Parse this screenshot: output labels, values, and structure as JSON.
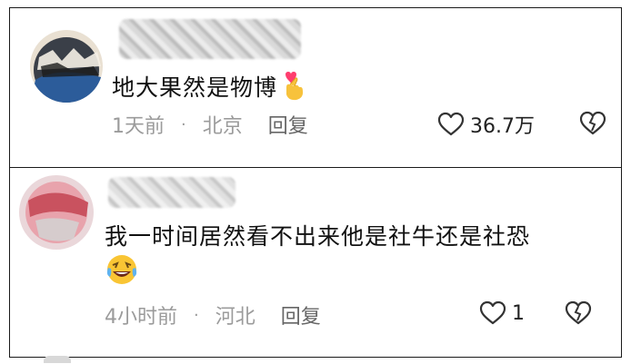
{
  "comments": [
    {
      "text": "地大果然是物博",
      "time": "1天前",
      "location": "北京",
      "reply_label": "回复",
      "likes": "36.7万",
      "emoji": "hand-heart-emoji"
    },
    {
      "text": "我一时间居然看不出来他是社牛还是社恐",
      "time": "4小时前",
      "location": "河北",
      "reply_label": "回复",
      "likes": "1",
      "emoji": "rolling-laughing-emoji"
    }
  ],
  "colors": {
    "meta_gray": "#9b9b9b",
    "text": "#111111",
    "border": "#1a1a1a"
  }
}
